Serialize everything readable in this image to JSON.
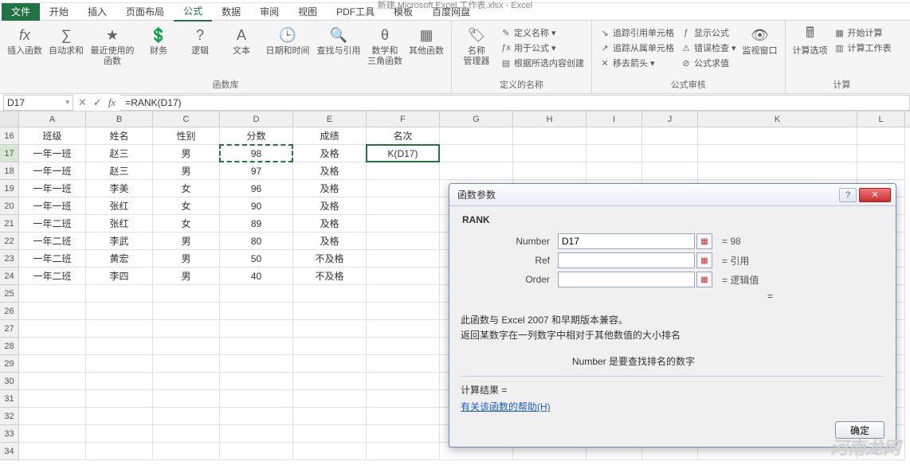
{
  "window_title": "新建 Microsoft Excel 工作表.xlsx - Excel",
  "tabs": {
    "file": "文件",
    "items": [
      "开始",
      "插入",
      "页面布局",
      "公式",
      "数据",
      "审阅",
      "视图",
      "PDF工具",
      "模板",
      "百度网盘"
    ],
    "active_index": 3
  },
  "ribbon": {
    "group_fnlib": "函数库",
    "group_names": "定义的名称",
    "group_audit": "公式审核",
    "group_calc": "计算",
    "insert_fn": "插入函数",
    "autosum": "自动求和",
    "recent": "最近使用的\n函数",
    "financial": "财务",
    "logical": "逻辑",
    "text": "文本",
    "datetime": "日期和时间",
    "lookup": "查找与引用",
    "mathtrig": "数学和\n三角函数",
    "morefn": "其他函数",
    "name_mgr": "名称\n管理器",
    "def_name": "定义名称",
    "use_in_formula": "用于公式",
    "create_sel": "根据所选内容创建",
    "trace_prec": "追踪引用单元格",
    "trace_dep": "追踪从属单元格",
    "remove_arrows": "移去箭头",
    "show_formula": "显示公式",
    "error_check": "错误检查",
    "eval_formula": "公式求值",
    "watch": "监视窗口",
    "calc_opts": "计算选项",
    "calc_now": "开始计算",
    "calc_sheet": "计算工作表"
  },
  "formula_bar": {
    "namebox": "D17",
    "formula": "=RANK(D17)"
  },
  "columns": [
    "A",
    "B",
    "C",
    "D",
    "E",
    "F",
    "G",
    "H",
    "I",
    "J",
    "K",
    "L"
  ],
  "row_numbers": [
    16,
    17,
    18,
    19,
    20,
    21,
    22,
    23,
    24,
    25,
    26,
    27,
    28,
    29,
    30,
    31,
    32,
    33,
    34
  ],
  "headers": [
    "班级",
    "姓名",
    "性别",
    "分数",
    "成绩",
    "名次"
  ],
  "rows": [
    [
      "一年一班",
      "赵三",
      "男",
      "98",
      "及格",
      "K(D17)"
    ],
    [
      "一年一班",
      "赵三",
      "男",
      "97",
      "及格",
      ""
    ],
    [
      "一年一班",
      "李美",
      "女",
      "96",
      "及格",
      ""
    ],
    [
      "一年一班",
      "张红",
      "女",
      "90",
      "及格",
      ""
    ],
    [
      "一年二班",
      "张红",
      "女",
      "89",
      "及格",
      ""
    ],
    [
      "一年二班",
      "李武",
      "男",
      "80",
      "及格",
      ""
    ],
    [
      "一年二班",
      "黄宏",
      "男",
      "50",
      "不及格",
      ""
    ],
    [
      "一年二班",
      "李四",
      "男",
      "40",
      "不及格",
      ""
    ]
  ],
  "dialog": {
    "title": "函数参数",
    "fn": "RANK",
    "args": {
      "number_label": "Number",
      "number_value": "D17",
      "number_result": "= 98",
      "ref_label": "Ref",
      "ref_value": "",
      "ref_result": "= 引用",
      "order_label": "Order",
      "order_value": "",
      "order_result": "= 逻辑值"
    },
    "eq_only": "=",
    "desc1": "此函数与 Excel 2007 和早期版本兼容。",
    "desc2": "返回某数字在一列数字中相对于其他数值的大小排名",
    "hint": "Number  是要查找排名的数字",
    "result_label": "计算结果 =",
    "help": "有关该函数的帮助(H)",
    "ok": "确定"
  },
  "watermark": "河南龙网"
}
